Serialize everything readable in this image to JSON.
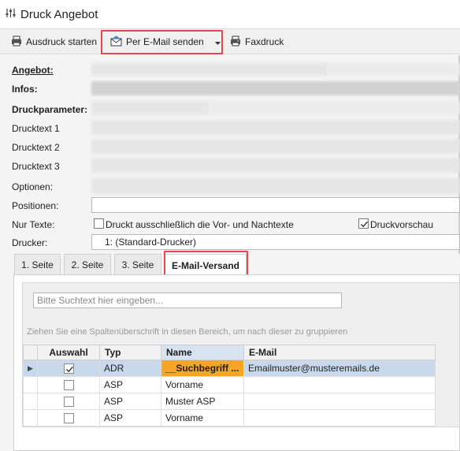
{
  "window": {
    "title": "Druck Angebot",
    "icon": "sliders-icon"
  },
  "toolbar": {
    "print_label": "Ausdruck starten",
    "email_label": "Per E-Mail senden",
    "fax_label": "Faxdruck",
    "highlight_color": "#e8474f"
  },
  "form": {
    "angebot_label": "Angebot:",
    "infos_label": "Infos:",
    "druckparameter_label": "Druckparameter:",
    "drucktext1_label": "Drucktext 1",
    "drucktext2_label": "Drucktext 2",
    "drucktext3_label": "Drucktext 3",
    "optionen_label": "Optionen:",
    "positionen_label": "Positionen:",
    "positionen_value": "",
    "nur_texte_label": "Nur Texte:",
    "nur_texte_checkbox_label": "Druckt ausschließlich die Vor- und Nachtexte",
    "nur_texte_checked": false,
    "druckvorschau_label": "Druckvorschau",
    "druckvorschau_checked": true,
    "drucker_label": "Drucker:",
    "drucker_value": "1: (Standard-Drucker)"
  },
  "tabs": [
    {
      "label": "1. Seite",
      "active": false
    },
    {
      "label": "2. Seite",
      "active": false
    },
    {
      "label": "3. Seite",
      "active": false
    },
    {
      "label": "E-Mail-Versand",
      "active": true
    }
  ],
  "grid": {
    "search_placeholder": "Bitte Suchtext hier eingeben...",
    "group_hint": "Ziehen Sie eine Spaltenüberschrift in diesen Bereich, um nach dieser zu gruppieren",
    "columns": [
      "Auswahl",
      "Typ",
      "Name",
      "E-Mail"
    ],
    "rows": [
      {
        "checked": true,
        "typ": "ADR",
        "name": "__Suchbegriff ...",
        "email": "Emailmuster@musteremails.de",
        "selected": true
      },
      {
        "checked": false,
        "typ": "ASP",
        "name": "Vorname",
        "email": "",
        "selected": false
      },
      {
        "checked": false,
        "typ": "ASP",
        "name": "Muster ASP",
        "email": "",
        "selected": false
      },
      {
        "checked": false,
        "typ": "ASP",
        "name": "Vorname",
        "email": "",
        "selected": false
      }
    ]
  }
}
